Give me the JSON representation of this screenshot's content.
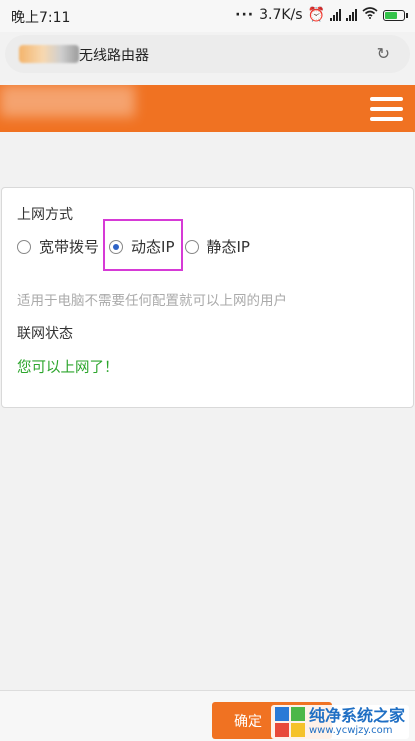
{
  "status_bar": {
    "time": "晚上7:11",
    "network_speed": "3.7K/s",
    "icons": [
      "dots-icon",
      "alarm-icon",
      "signal-icon",
      "signal-icon",
      "wifi-icon",
      "battery-icon"
    ]
  },
  "address_bar": {
    "title": "无线路由器",
    "refresh_icon": "refresh-icon"
  },
  "header": {
    "menu_icon": "hamburger-menu-icon",
    "accent_color": "#f07222"
  },
  "connection": {
    "section_label": "上网方式",
    "options": [
      {
        "label": "宽带拨号",
        "selected": false
      },
      {
        "label": "动态IP",
        "selected": true
      },
      {
        "label": "静态IP",
        "selected": false
      }
    ],
    "hint": "适用于电脑不需要任何配置就可以上网的用户",
    "status_label": "联网状态",
    "status_value": "您可以上网了！",
    "status_color": "#2ca52c",
    "highlight_color": "#d63ad6"
  },
  "footer": {
    "confirm_label": "确定"
  },
  "watermark": {
    "title": "纯净系统之家",
    "url": "www.ycwjzy.com"
  }
}
